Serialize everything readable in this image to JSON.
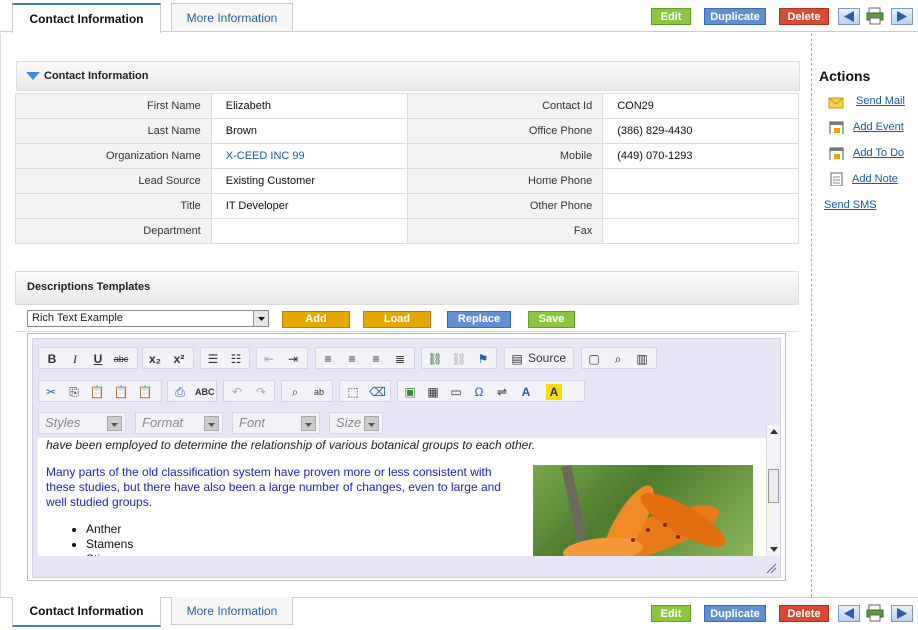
{
  "tabs": {
    "contact": "Contact Information",
    "more": "More Information"
  },
  "toolbar": {
    "edit": "Edit",
    "duplicate": "Duplicate",
    "delete": "Delete"
  },
  "contact": {
    "section_title": "Contact Information",
    "rows": [
      {
        "l1": "First Name",
        "v1": "Elizabeth",
        "l2": "Contact Id",
        "v2": "CON29"
      },
      {
        "l1": "Last Name",
        "v1": "Brown",
        "l2": "Office Phone",
        "v2": "(386) 829-4430"
      },
      {
        "l1": "Organization Name",
        "v1": "X-CEED INC 99",
        "l2": "Mobile",
        "v2": "(449) 070-1293"
      },
      {
        "l1": "Lead Source",
        "v1": "Existing Customer",
        "l2": "Home Phone",
        "v2": ""
      },
      {
        "l1": "Title",
        "v1": "IT Developer",
        "l2": "Other Phone",
        "v2": ""
      },
      {
        "l1": "Department",
        "v1": "",
        "l2": "Fax",
        "v2": ""
      }
    ]
  },
  "templates": {
    "title": "Descriptions Templates",
    "selected": "Rich Text Example",
    "add": "Add",
    "load": "Load",
    "replace": "Replace",
    "save": "Save"
  },
  "editor": {
    "source_label": "Source",
    "styles": "Styles",
    "format": "Format",
    "font": "Font",
    "size": "Size",
    "line1": "have been employed to determine the relationship of various botanical groups to each other.",
    "para": "Many parts of the old classification system have proven more or less consistent with these studies, but there have also been a large number of changes, even to large and well studied groups.",
    "list": [
      "Anther",
      "Stamens",
      "Sti..."
    ]
  },
  "actions": {
    "title": "Actions",
    "send_mail": "Send Mail",
    "add_event": "Add Event",
    "add_todo": "Add To Do",
    "add_note": "Add Note",
    "send_sms": "Send SMS"
  },
  "colors": {
    "edit": "#8cc63f",
    "duplicate": "#5f90d4",
    "delete": "#d94b33",
    "template_btn": "#e6a800",
    "replace": "#5f90d4",
    "save": "#8cc63f",
    "link": "#1a5aa6"
  }
}
